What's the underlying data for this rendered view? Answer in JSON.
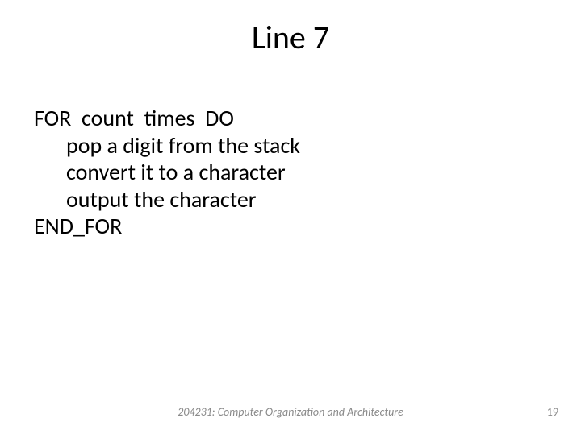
{
  "title": "Line 7",
  "body": {
    "line1": "FOR  count  times  DO",
    "line2": "pop a digit from the stack",
    "line3": "convert it to a character",
    "line4": "output the character",
    "line5": "END_FOR"
  },
  "footer": "204231: Computer Organization and Architecture",
  "page_number": "19"
}
